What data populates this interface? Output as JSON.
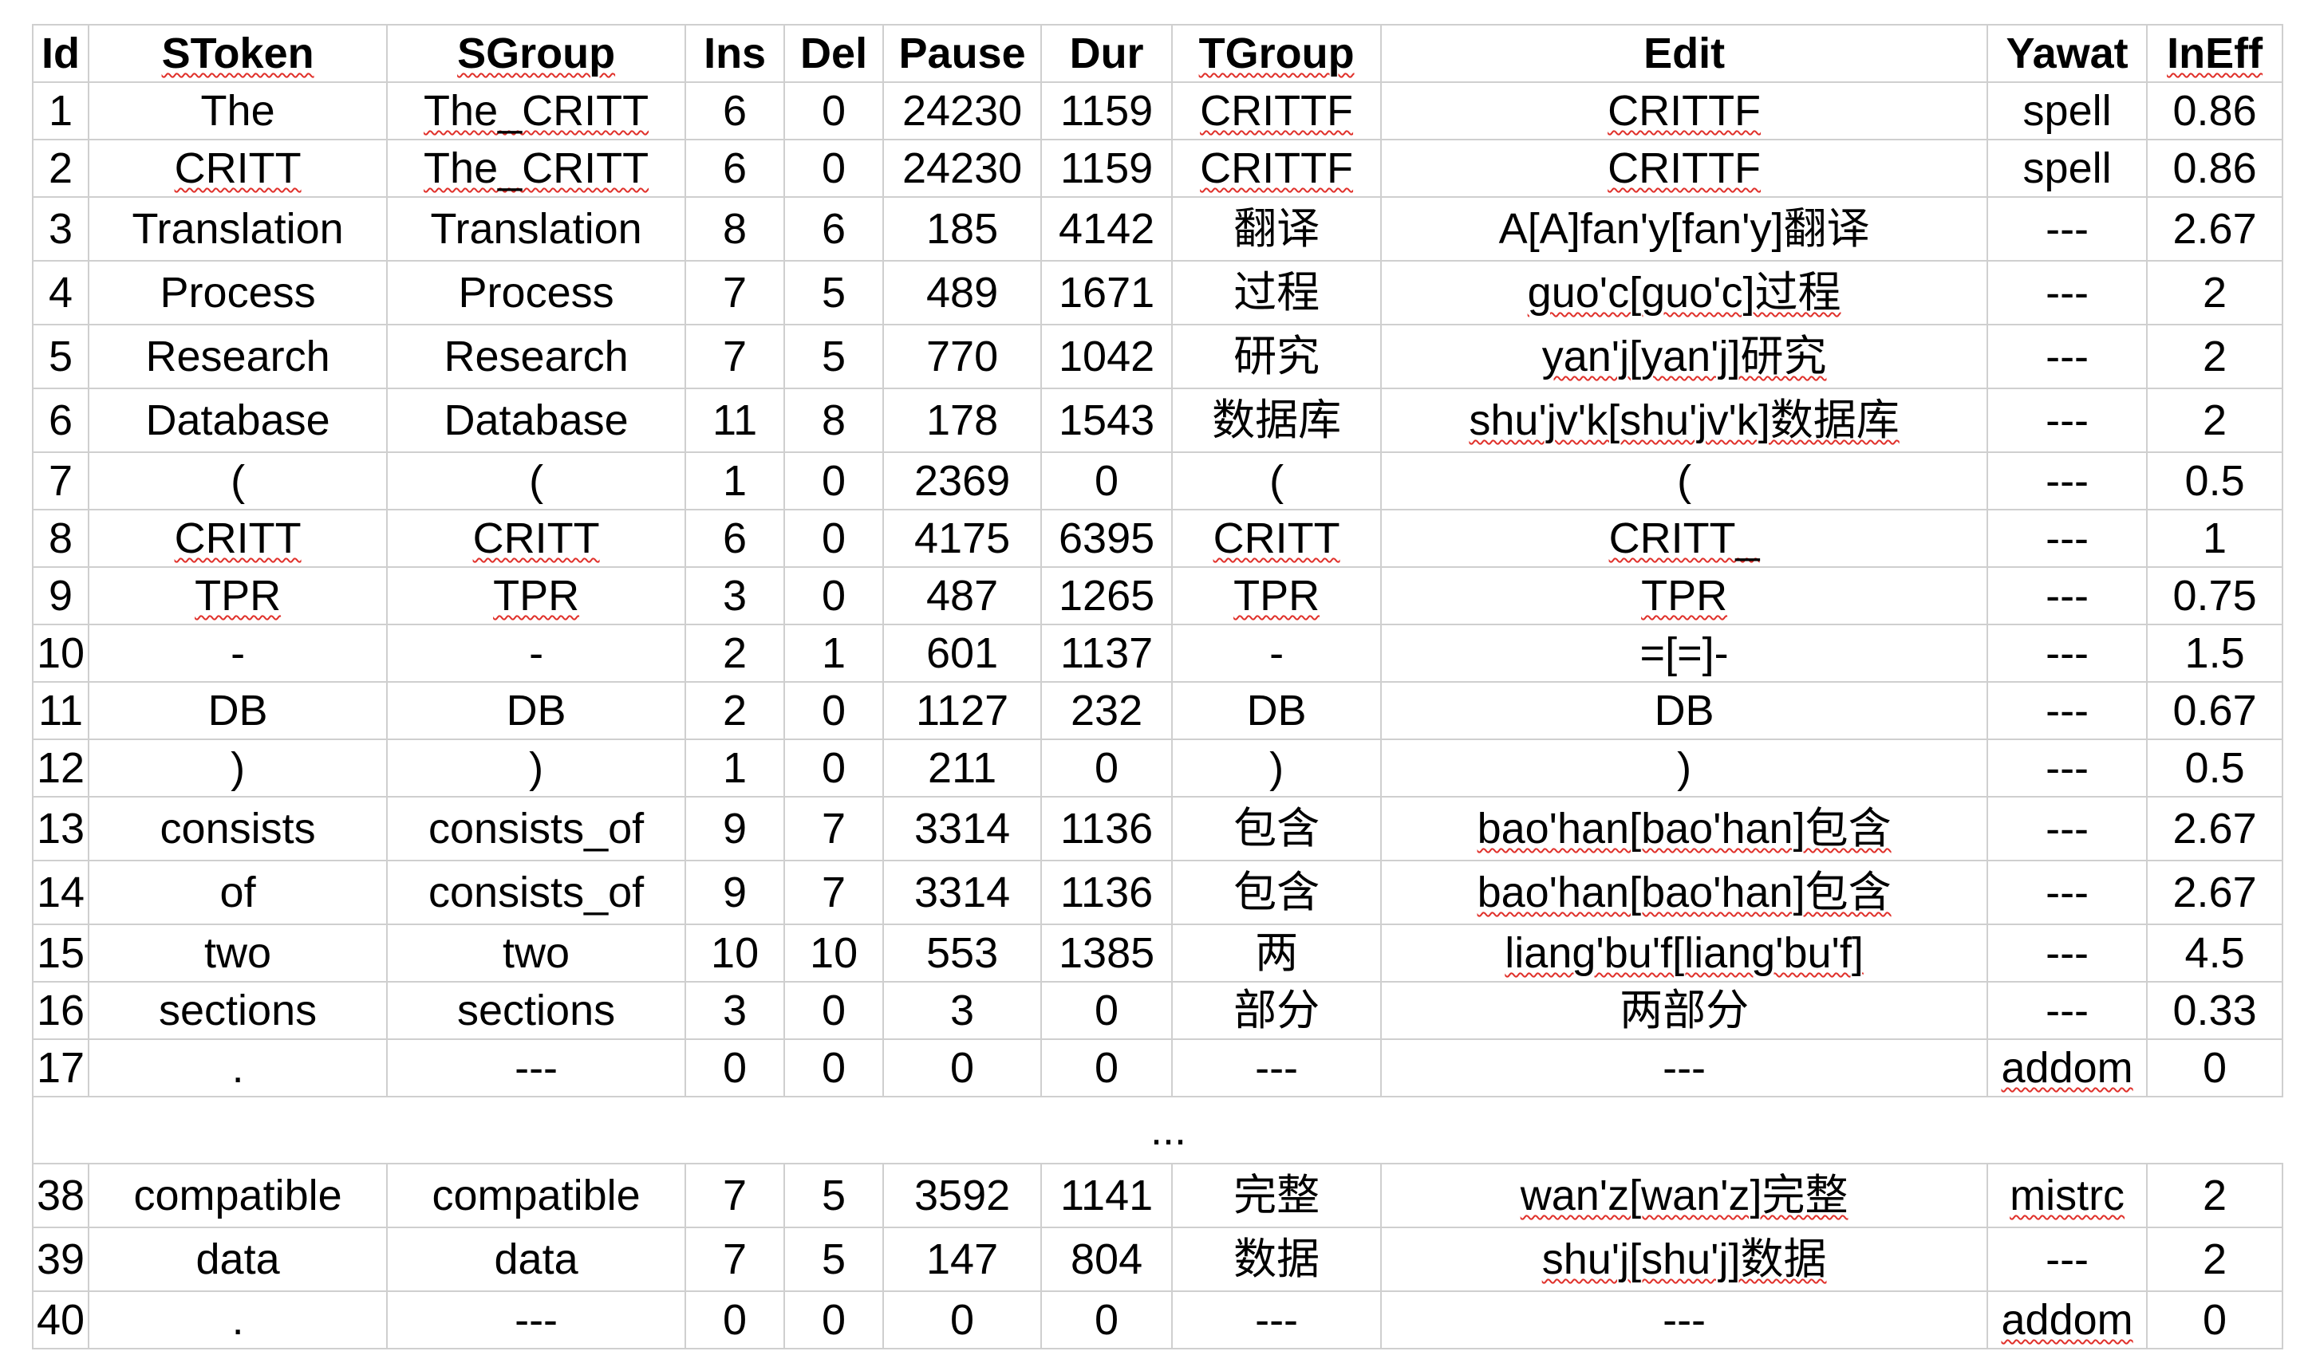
{
  "columns": [
    "Id",
    "SToken",
    "SGroup",
    "Ins",
    "Del",
    "Pause",
    "Dur",
    "TGroup",
    "Edit",
    "Yawat",
    "InEff"
  ],
  "ellipsis": "...",
  "rows_top": [
    [
      "1",
      "The",
      "The_CRITT",
      "6",
      "0",
      "24230",
      "1159",
      "CRITTF",
      "CRITTF",
      "spell",
      "0.86"
    ],
    [
      "2",
      "CRITT",
      "The_CRITT",
      "6",
      "0",
      "24230",
      "1159",
      "CRITTF",
      "CRITTF",
      "spell",
      "0.86"
    ],
    [
      "3",
      "Translation",
      "Translation",
      "8",
      "6",
      "185",
      "4142",
      "翻译",
      "A[A]fan'y[fan'y]翻译",
      "---",
      "2.67"
    ],
    [
      "4",
      "Process",
      "Process",
      "7",
      "5",
      "489",
      "1671",
      "过程",
      "guo'c[guo'c]过程",
      "---",
      "2"
    ],
    [
      "5",
      "Research",
      "Research",
      "7",
      "5",
      "770",
      "1042",
      "研究",
      "yan'j[yan'j]研究",
      "---",
      "2"
    ],
    [
      "6",
      "Database",
      "Database",
      "11",
      "8",
      "178",
      "1543",
      "数据库",
      "shu'jv'k[shu'jv'k]数据库",
      "---",
      "2"
    ],
    [
      "7",
      "(",
      "(",
      "1",
      "0",
      "2369",
      "0",
      "(",
      "(",
      "---",
      "0.5"
    ],
    [
      "8",
      "CRITT",
      "CRITT",
      "6",
      "0",
      "4175",
      "6395",
      "CRITT",
      "CRITT_",
      "---",
      "1"
    ],
    [
      "9",
      "TPR",
      "TPR",
      "3",
      "0",
      "487",
      "1265",
      "TPR",
      "TPR",
      "---",
      "0.75"
    ],
    [
      "10",
      "-",
      "-",
      "2",
      "1",
      "601",
      "1137",
      "-",
      "=[=]-",
      "---",
      "1.5"
    ],
    [
      "11",
      "DB",
      "DB",
      "2",
      "0",
      "1127",
      "232",
      "DB",
      "DB",
      "---",
      "0.67"
    ],
    [
      "12",
      ")",
      ")",
      "1",
      "0",
      "211",
      "0",
      ")",
      ")",
      "---",
      "0.5"
    ],
    [
      "13",
      "consists",
      "consists_of",
      "9",
      "7",
      "3314",
      "1136",
      "包含",
      "bao'han[bao'han]包含",
      "---",
      "2.67"
    ],
    [
      "14",
      "of",
      "consists_of",
      "9",
      "7",
      "3314",
      "1136",
      "包含",
      "bao'han[bao'han]包含",
      "---",
      "2.67"
    ],
    [
      "15",
      "two",
      "two",
      "10",
      "10",
      "553",
      "1385",
      "两",
      "liang'bu'f[liang'bu'f]",
      "---",
      "4.5"
    ],
    [
      "16",
      "sections",
      "sections",
      "3",
      "0",
      "3",
      "0",
      "部分",
      "两部分",
      "---",
      "0.33"
    ],
    [
      "17",
      ".",
      "---",
      "0",
      "0",
      "0",
      "0",
      "---",
      "---",
      "addom",
      "0"
    ]
  ],
  "rows_bottom": [
    [
      "38",
      "compatible",
      "compatible",
      "7",
      "5",
      "3592",
      "1141",
      "完整",
      "wan'z[wan'z]完整",
      "mistrc",
      "2"
    ],
    [
      "39",
      "data",
      "data",
      "7",
      "5",
      "147",
      "804",
      "数据",
      "shu'j[shu'j]数据",
      "---",
      "2"
    ],
    [
      "40",
      ".",
      "---",
      "0",
      "0",
      "0",
      "0",
      "---",
      "---",
      "addom",
      "0"
    ]
  ],
  "squiggle_cells": [
    [
      0,
      2
    ],
    [
      0,
      7
    ],
    [
      0,
      8
    ],
    [
      1,
      1
    ],
    [
      1,
      2
    ],
    [
      1,
      7
    ],
    [
      1,
      8
    ],
    [
      3,
      8
    ],
    [
      4,
      8
    ],
    [
      5,
      8
    ],
    [
      7,
      1
    ],
    [
      7,
      2
    ],
    [
      7,
      7
    ],
    [
      7,
      8
    ],
    [
      8,
      1
    ],
    [
      8,
      2
    ],
    [
      8,
      7
    ],
    [
      8,
      8
    ],
    [
      12,
      8
    ],
    [
      13,
      8
    ],
    [
      14,
      8
    ],
    [
      16,
      9
    ]
  ],
  "squiggle_header": [
    "SToken",
    "SGroup",
    "TGroup",
    "InEff"
  ],
  "squiggle_bottom": [
    [
      0,
      8
    ],
    [
      0,
      9
    ],
    [
      1,
      8
    ],
    [
      2,
      9
    ]
  ],
  "colors": {
    "grid": "#cfcfcf",
    "spellcheck": "#e0302a"
  }
}
